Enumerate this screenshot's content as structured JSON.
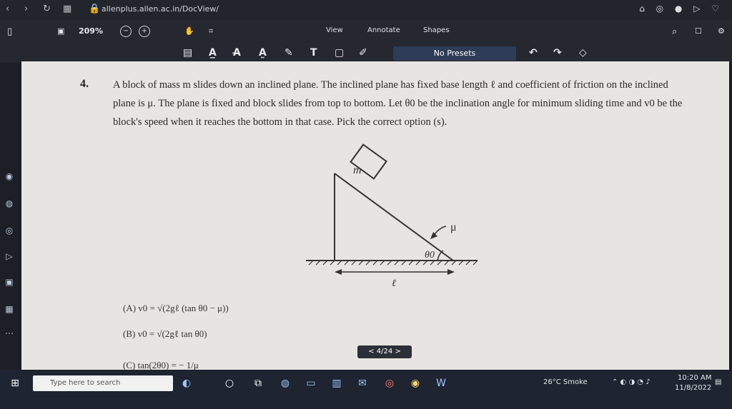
{
  "browser": {
    "url": "allenplus.allen.ac.in/DocView/"
  },
  "toolbar": {
    "zoom": "209%",
    "menu_view": "View",
    "menu_annotate": "Annotate",
    "menu_shapes": "Shapes"
  },
  "annotation_bar": {
    "presets": "No Presets"
  },
  "question": {
    "number": "4.",
    "text": "A block of mass m slides down an inclined plane. The inclined plane has fixed base length ℓ and coefficient of friction on the inclined plane is μ. The plane is fixed and block slides from top to bottom. Let θ0 be the inclination angle for minimum sliding time and v0 be the block's speed when it reaches the bottom in that case. Pick the correct option (s).",
    "diagram": {
      "block_label": "m",
      "friction_label": "μ",
      "angle_label": "θ0",
      "base_label": "ℓ"
    },
    "options": [
      "(A)  v0 = √(2gℓ (tan θ0 − μ))",
      "(B)  v0 = √(2gℓ tan θ0)",
      "(C)  tan(2θ0) = − 1/μ"
    ]
  },
  "pager": "< 4/24 >",
  "taskbar": {
    "search_placeholder": "Type here to search",
    "weather": "26°C  Smoke",
    "time": "10:20 AM",
    "date": "11/8/2022"
  }
}
